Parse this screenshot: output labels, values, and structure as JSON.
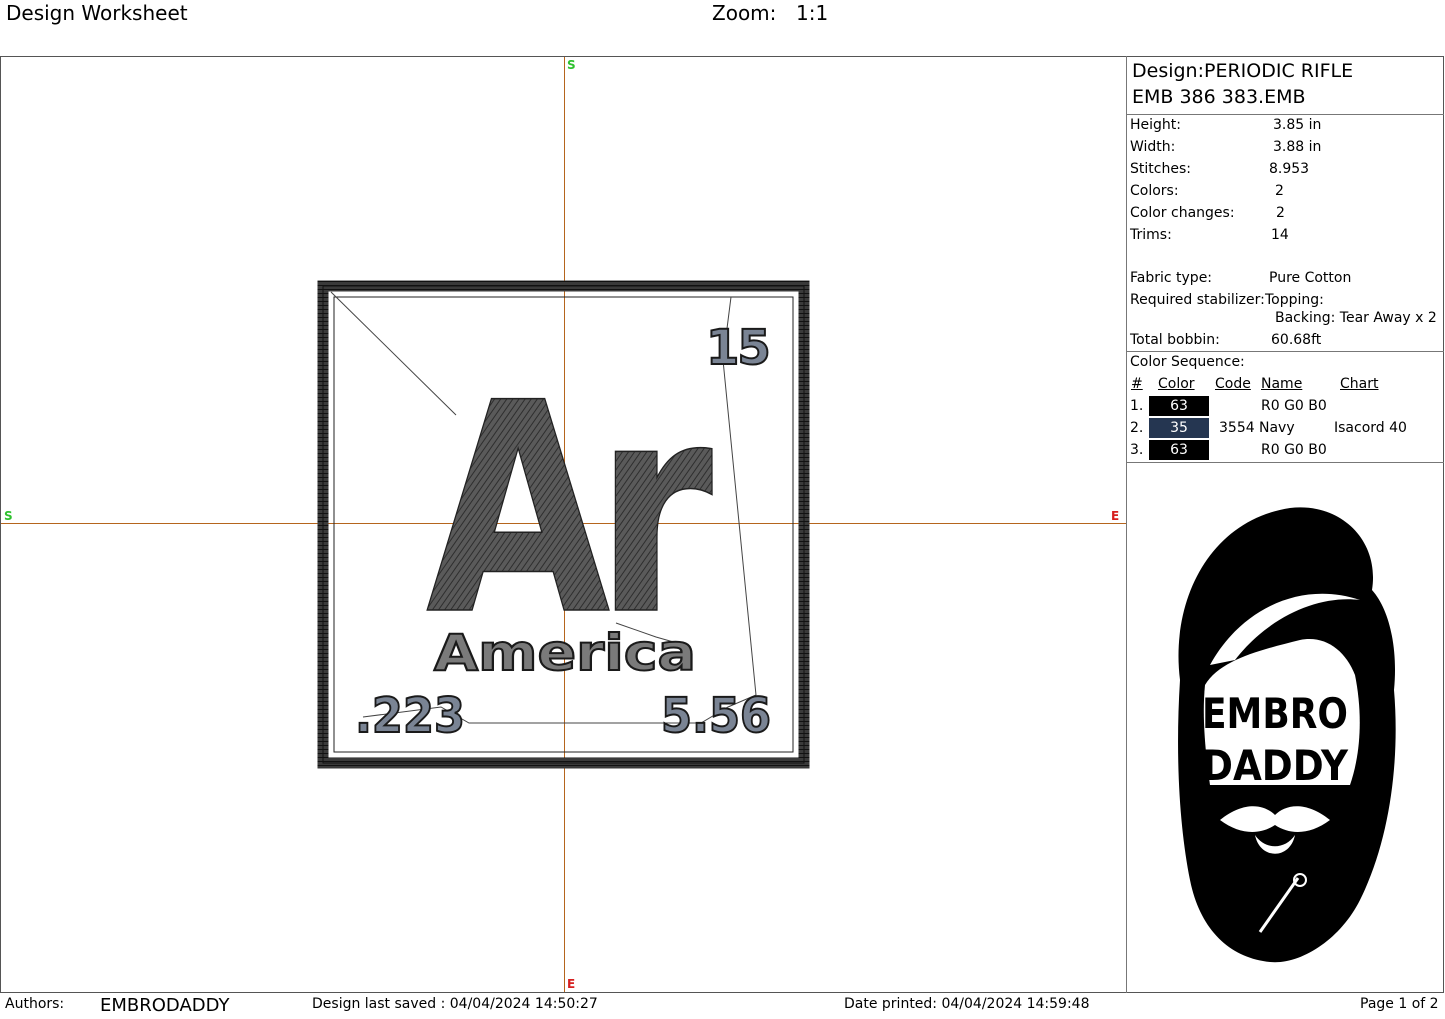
{
  "header": {
    "title": "Design Worksheet",
    "zoom_label": "Zoom:",
    "zoom_value": "1:1"
  },
  "design": {
    "symbol": "Ar",
    "number": "15",
    "name": "America",
    "left_value": ".223",
    "right_value": "5.56",
    "axis_marks": {
      "top": "S",
      "left": "S",
      "right": "E",
      "bottom": "E"
    }
  },
  "info": {
    "design_line1": "Design:PERIODIC RIFLE",
    "design_line2": "EMB 386 383.EMB",
    "rows": [
      {
        "label": "Height:",
        "value": "3.85 in"
      },
      {
        "label": "Width:",
        "value": "3.88 in"
      },
      {
        "label": "Stitches:",
        "value": "8.953"
      },
      {
        "label": "Colors:",
        "value": "2"
      },
      {
        "label": "Color changes:",
        "value": "2"
      },
      {
        "label": "Trims:",
        "value": "14"
      }
    ],
    "fabric_label": "Fabric type:",
    "fabric_value": "Pure Cotton",
    "stabilizer_label": "Required stabilizer:",
    "topping": "Topping:",
    "backing": "Backing: Tear Away x 2",
    "bobbin_label": "Total bobbin:",
    "bobbin_value": "60.68ft",
    "color_sequence_title": "Color Sequence:",
    "columns": {
      "num": "#",
      "color": "Color",
      "code": "Code",
      "name": "Name",
      "chart": "Chart"
    },
    "sequence": [
      {
        "num": "1.",
        "color": "63",
        "swatch": "#000000",
        "code": "",
        "name": "R0 G0 B0",
        "chart": ""
      },
      {
        "num": "2.",
        "color": "35",
        "swatch": "#253651",
        "code": "3554",
        "name": "Navy",
        "chart": "Isacord 40"
      },
      {
        "num": "3.",
        "color": "63",
        "swatch": "#000000",
        "code": "",
        "name": "R0 G0 B0",
        "chart": ""
      }
    ]
  },
  "logo": {
    "line1": "EMBRO",
    "line2": "DADDY"
  },
  "footer": {
    "authors_label": "Authors:",
    "authors_value": "EMBRODADDY",
    "saved": "Design last saved : 04/04/2024 14:50:27",
    "printed": "Date printed: 04/04/2024 14:59:48",
    "page": "Page 1 of 2"
  }
}
